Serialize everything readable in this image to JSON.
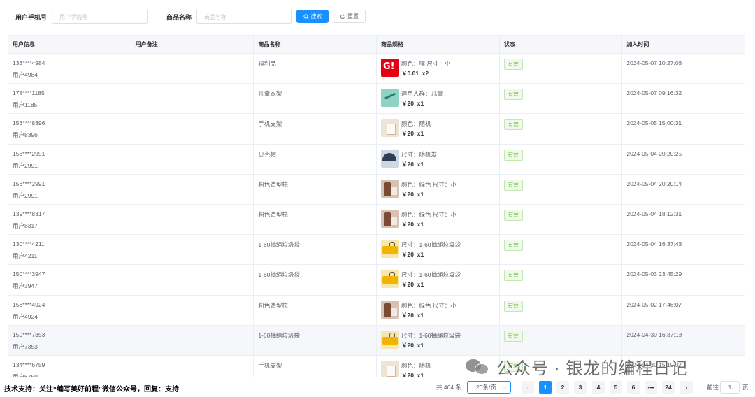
{
  "search": {
    "phone_label": "用户手机号",
    "phone_placeholder": "用户手机号",
    "product_label": "商品名称",
    "product_placeholder": "商品名称",
    "search_button": "搜索",
    "reset_button": "重置"
  },
  "table": {
    "columns": [
      "用户信息",
      "用户备注",
      "商品名称",
      "商品规格",
      "状态",
      "加入时间"
    ],
    "rows": [
      {
        "phone": "133****4984",
        "user": "用户4984",
        "note": "",
        "product": "福利品",
        "thumb": "red",
        "spec": "颜色：嘿 尺寸：小",
        "price": "￥0.01",
        "qty": "x2",
        "status": "有效",
        "time": "2024-05-07 10:27:08"
      },
      {
        "phone": "178****1185",
        "user": "用户1185",
        "note": "",
        "product": "儿童衣架",
        "thumb": "green",
        "spec": "适用人群：儿童",
        "price": "￥20",
        "qty": "x1",
        "status": "有效",
        "time": "2024-05-07 09:16:32"
      },
      {
        "phone": "153****8396",
        "user": "用户8396",
        "note": "",
        "product": "手机支架",
        "thumb": "tan",
        "spec": "颜色：随机",
        "price": "￥20",
        "qty": "x1",
        "status": "有效",
        "time": "2024-05-05 15:00:31"
      },
      {
        "phone": "156****2991",
        "user": "用户2991",
        "note": "",
        "product": "贝壳帽",
        "thumb": "hat",
        "spec": "尺寸：随机发",
        "price": "￥20",
        "qty": "x1",
        "status": "有效",
        "time": "2024-05-04 20:20:25"
      },
      {
        "phone": "156****2991",
        "user": "用户2991",
        "note": "",
        "product": "粉色造型梳",
        "thumb": "comb",
        "spec": "颜色：绿色 尺寸：小",
        "price": "￥20",
        "qty": "x1",
        "status": "有效",
        "time": "2024-05-04 20:20:14"
      },
      {
        "phone": "139****8317",
        "user": "用户8317",
        "note": "",
        "product": "粉色造型梳",
        "thumb": "comb",
        "spec": "颜色：绿色 尺寸：小",
        "price": "￥20",
        "qty": "x1",
        "status": "有效",
        "time": "2024-05-04 18:12:31"
      },
      {
        "phone": "130****4211",
        "user": "用户4211",
        "note": "",
        "product": "1-60抽绳垃圾袋",
        "thumb": "bag",
        "spec": "尺寸：1-60抽绳垃圾袋",
        "price": "￥20",
        "qty": "x1",
        "status": "有效",
        "time": "2024-05-04 16:37:43"
      },
      {
        "phone": "150****3947",
        "user": "用户3947",
        "note": "",
        "product": "1-60抽绳垃圾袋",
        "thumb": "bag",
        "spec": "尺寸：1-60抽绳垃圾袋",
        "price": "￥20",
        "qty": "x1",
        "status": "有效",
        "time": "2024-05-03 23:45:29"
      },
      {
        "phone": "158****4924",
        "user": "用户4924",
        "note": "",
        "product": "粉色造型梳",
        "thumb": "comb",
        "spec": "颜色：绿色 尺寸：小",
        "price": "￥20",
        "qty": "x1",
        "status": "有效",
        "time": "2024-05-02 17:46:07"
      },
      {
        "phone": "159****7353",
        "user": "用户7353",
        "note": "",
        "product": "1-60抽绳垃圾袋",
        "thumb": "bag",
        "spec": "尺寸：1-60抽绳垃圾袋",
        "price": "￥20",
        "qty": "x1",
        "status": "有效",
        "time": "2024-04-30 16:37:18"
      },
      {
        "phone": "134****6759",
        "user": "用户6759",
        "note": "",
        "product": "手机支架",
        "thumb": "tan",
        "spec": "颜色：随机",
        "price": "￥20",
        "qty": "x1",
        "status": "有效",
        "time": "2024-04-30 15:19:07"
      }
    ]
  },
  "footer": {
    "note": "技术支持：关注“编写美好前程”微信公众号，回复：支持",
    "total": "共 464 条",
    "page_size": "20条/页",
    "pages": [
      "1",
      "2",
      "3",
      "4",
      "5",
      "6",
      "•••",
      "24"
    ],
    "current_page": "1",
    "jump_prefix": "前往",
    "jump_value": "1",
    "jump_suffix": "页"
  },
  "watermark": {
    "text": "公众号 · 银龙的编程日记"
  },
  "colors": {
    "primary": "#1890ff",
    "success": "#67c23a",
    "header_bg": "#f5f7fa",
    "border": "#ebeef5"
  },
  "icons": [
    "search-icon",
    "refresh-icon",
    "chevron-down-icon",
    "chevron-left-icon",
    "chevron-right-icon",
    "wechat-icon"
  ]
}
